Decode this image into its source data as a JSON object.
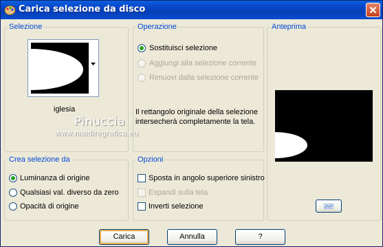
{
  "window": {
    "title": "Carica selezione da disco"
  },
  "selezione": {
    "legend": "Selezione",
    "file_name": "iglesia"
  },
  "operazione": {
    "legend": "Operazione",
    "options": [
      {
        "label": "Sostituisci selezione",
        "checked": true,
        "enabled": true
      },
      {
        "label": "Aggiungi alla selezione corrente",
        "checked": false,
        "enabled": false
      },
      {
        "label": "Rimuovi dalla selezione corrente",
        "checked": false,
        "enabled": false
      }
    ],
    "note_line1": "Il rettangolo originale della selezione",
    "note_line2": "intersecherà completamente la tela."
  },
  "anteprima": {
    "legend": "Anteprima"
  },
  "crea": {
    "legend": "Crea selezione da",
    "options": [
      {
        "label": "Luminanza di origine",
        "checked": true
      },
      {
        "label": "Qualsiasi val. diverso da zero",
        "checked": false
      },
      {
        "label": "Opacità di origine",
        "checked": false
      }
    ]
  },
  "opzioni": {
    "legend": "Opzioni",
    "items": [
      {
        "label": "Sposta in angolo superiore sinistro",
        "checked": false,
        "enabled": true
      },
      {
        "label": "Espandi sulla tela",
        "checked": false,
        "enabled": false
      },
      {
        "label": "Inverti selezione",
        "checked": false,
        "enabled": true
      }
    ]
  },
  "buttons": {
    "ok": "Carica",
    "cancel": "Annulla",
    "help": "?"
  },
  "watermark": {
    "line1": "Pinuccia",
    "line2": "www.maidiregrafica.eu"
  },
  "colors": {
    "title_bar": "#0a4bd0",
    "legend_text": "#0046d5",
    "dialog_bg": "#ece9d8"
  }
}
